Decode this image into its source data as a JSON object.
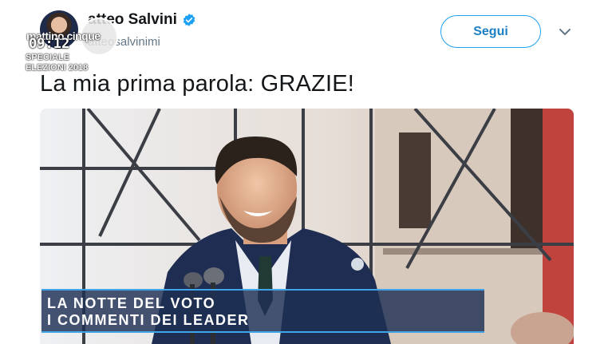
{
  "tweet": {
    "display_name": "atteo Salvini",
    "handle": "atteosalvinimi",
    "follow_label": "Segui",
    "text": "La mia prima parola: GRAZIE!",
    "icons": {
      "verified": "verified-badge-icon",
      "menu": "chevron-down-icon"
    }
  },
  "tv_overlay": {
    "brand": "mattino cinque",
    "time": "09:12",
    "special_line1": "SPECIALE",
    "special_line2": "ELEZIONI 2018"
  },
  "banner": {
    "line1": "LA NOTTE DEL VOTO",
    "line2": "I COMMENTI DEI LEADER"
  },
  "colors": {
    "accent": "#1da1f2",
    "banner_bg": "#1e3054",
    "banner_border": "#3fa4e8"
  }
}
